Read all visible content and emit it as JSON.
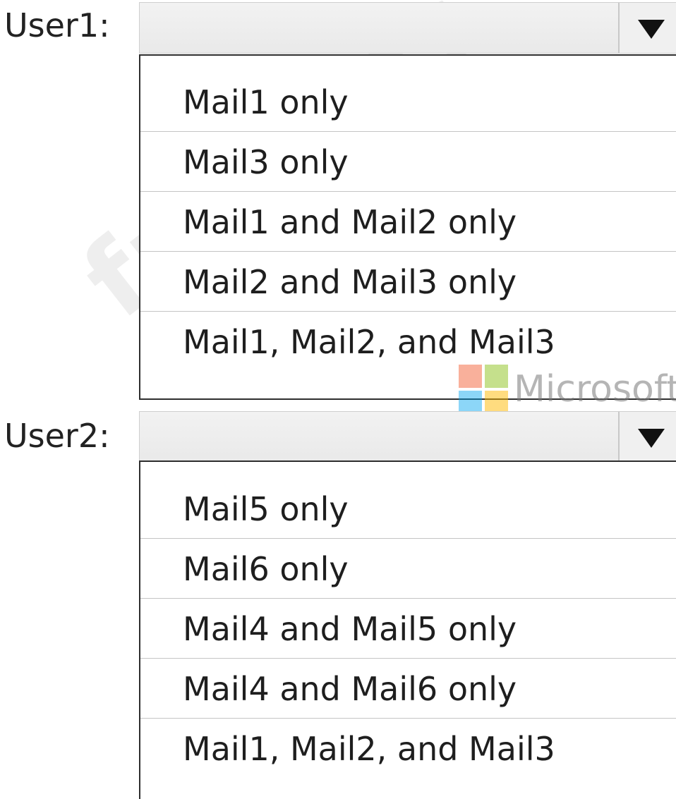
{
  "user1": {
    "label": "User1:",
    "selected_value": "",
    "options": [
      "Mail1 only",
      "Mail3 only",
      "Mail1 and Mail2 only",
      "Mail2 and Mail3 only",
      "Mail1, Mail2, and Mail3"
    ]
  },
  "user2": {
    "label": "User2:",
    "selected_value": "",
    "options": [
      "Mail5 only",
      "Mail6 only",
      "Mail4 and Mail5 only",
      "Mail4 and Mail6 only",
      "Mail1, Mail2, and Mail3"
    ]
  },
  "watermark": {
    "text": "freeqas.com",
    "brand_text": "Microsoft",
    "brand_colors": [
      "#f25022",
      "#7fba00",
      "#00a4ef",
      "#ffb900"
    ]
  },
  "icons": {
    "dropdown_caret": "chevron-down-icon"
  }
}
